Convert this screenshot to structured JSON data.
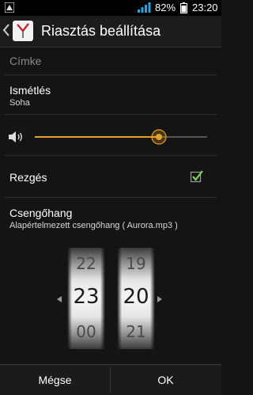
{
  "status_bar": {
    "battery": "82%",
    "time": "23:20"
  },
  "header": {
    "title": "Riasztás beállítása"
  },
  "settings": {
    "label_placeholder": "Címke",
    "repeat": {
      "title": "Ismétlés",
      "value": "Soha"
    },
    "volume": {
      "level": 0.72
    },
    "vibrate": {
      "title": "Rezgés",
      "checked": true
    },
    "ringtone": {
      "title": "Csengőhang",
      "value": "Alapértelmezett csengőhang ( Aurora.mp3 )"
    }
  },
  "time_picker": {
    "hours": {
      "prev": "22",
      "current": "23",
      "next": "00"
    },
    "minutes": {
      "prev": "19",
      "current": "20",
      "next": "21"
    }
  },
  "buttons": {
    "cancel": "Mégse",
    "ok": "OK"
  },
  "colors": {
    "accent": "#e6a224",
    "check": "#7fd35a"
  }
}
